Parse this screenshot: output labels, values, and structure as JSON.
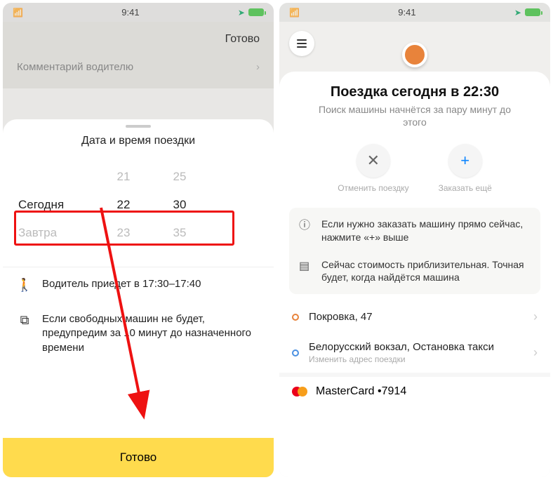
{
  "status": {
    "time": "9:41"
  },
  "left": {
    "done": "Готово",
    "comment_placeholder": "Комментарий водителю",
    "sheet_title": "Дата и время поездки",
    "picker": {
      "prev_day": "",
      "prev_hour": "21",
      "prev_min": "25",
      "sel_day": "Сегодня",
      "sel_hour": "22",
      "sel_min": "30",
      "next_day": "Завтра",
      "next_hour": "23",
      "next_min": "35"
    },
    "eta": "Водитель приедет в 17:30–17:40",
    "warning": "Если свободных машин не будет, предупредим за 10 минут до назначенного времени",
    "button": "Готово"
  },
  "right": {
    "title": "Поездка сегодня в 22:30",
    "subtitle": "Поиск машины начнётся за пару минут до этого",
    "cancel_label": "Отменить поездку",
    "add_label": "Заказать ещё",
    "notice1": "Если нужно заказать машину прямо сейчас, нажмите «+» выше",
    "notice2": "Сейчас стоимость приблизительная. Точная будет, когда найдётся машина",
    "from": "Покровка, 47",
    "to": "Белорусский вокзал, Остановка такси",
    "to_sub": "Изменить адрес поездки",
    "payment": "MasterCard •7914"
  }
}
